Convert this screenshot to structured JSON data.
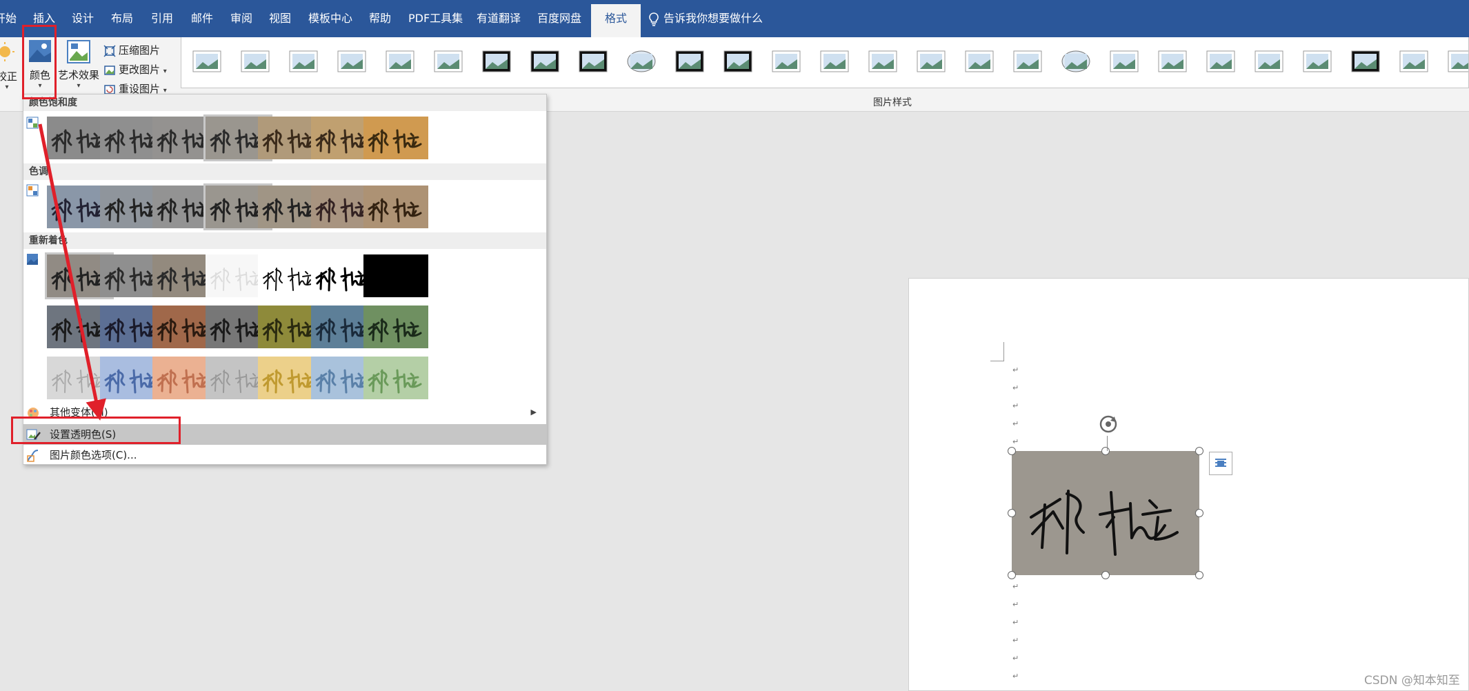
{
  "tabs": [
    "开始",
    "插入",
    "设计",
    "布局",
    "引用",
    "邮件",
    "审阅",
    "视图",
    "模板中心",
    "帮助",
    "PDF工具集",
    "有道翻译",
    "百度网盘",
    "格式"
  ],
  "active_tab": "格式",
  "tell_me": "告诉我你想要做什么",
  "ribbon": {
    "correct_label": "校正",
    "color_label": "颜色",
    "art_label": "艺术效果",
    "compress_label": "压缩图片",
    "change_label": "更改图片",
    "reset_label": "重设图片",
    "styles_group_label": "图片样式"
  },
  "menu": {
    "saturation_header": "颜色饱和度",
    "tone_header": "色调",
    "recolor_header": "重新着色",
    "more_variants": "其他变体(M)",
    "set_transparent": "设置透明色(S)",
    "color_options": "图片颜色选项(C)..."
  },
  "signature_text": "邴松",
  "watermark": "CSDN @知本知至",
  "colors": {
    "tabbar": "#2b579a",
    "ribbon": "#f3f3f3",
    "annotation": "#e0202a",
    "highlight": "#c6c6c6"
  }
}
